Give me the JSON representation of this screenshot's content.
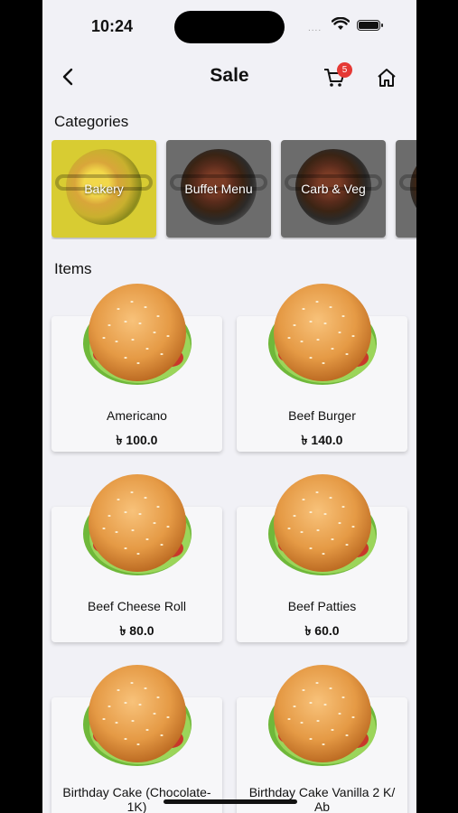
{
  "status_bar": {
    "time": "10:24",
    "signal_dots": "....",
    "wifi_icon": "wifi-icon",
    "battery_icon": "battery-icon"
  },
  "nav": {
    "title": "Sale",
    "back_icon": "chevron-left-icon",
    "cart_icon": "cart-icon",
    "cart_count": "5",
    "home_icon": "home-icon"
  },
  "categories": {
    "heading": "Categories",
    "items": [
      {
        "label": "Bakery",
        "selected": true
      },
      {
        "label": "Buffet Menu",
        "selected": false
      },
      {
        "label": "Carb & Veg",
        "selected": false
      },
      {
        "label": "",
        "selected": false
      }
    ]
  },
  "items": {
    "heading": "Items",
    "products": [
      {
        "name": "Americano",
        "price": "৳ 100.0"
      },
      {
        "name": "Beef Burger",
        "price": "৳ 140.0"
      },
      {
        "name": "Beef Cheese Roll",
        "price": "৳ 80.0"
      },
      {
        "name": "Beef Patties",
        "price": "৳ 60.0"
      },
      {
        "name": "Birthday  Cake (Chocolate-1K)",
        "price": ""
      },
      {
        "name": "Birthday Cake Vanilla 2 K/ Ab",
        "price": ""
      }
    ]
  },
  "colors": {
    "accent_selected": "#d8cc32",
    "badge": "#e53935",
    "background": "#f1f1f6"
  }
}
